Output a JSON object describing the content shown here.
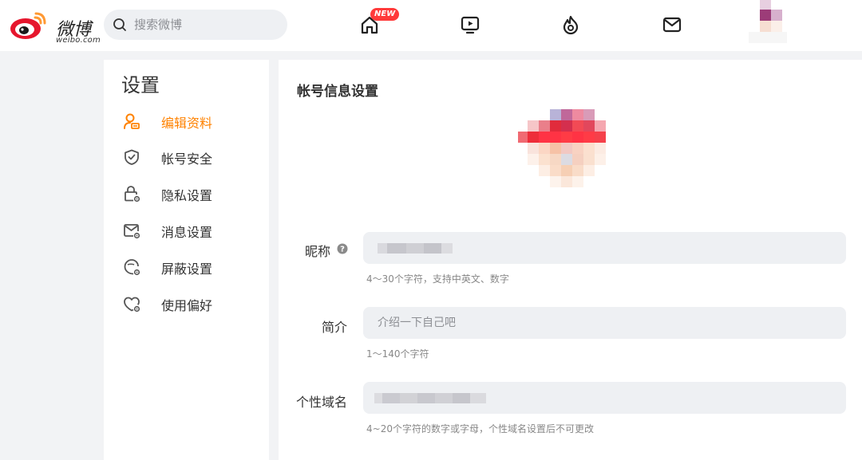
{
  "header": {
    "logo_text": "微博",
    "logo_sub": "weibo.com",
    "search_placeholder": "搜索微博",
    "nav": [
      {
        "name": "home",
        "badge": "NEW"
      },
      {
        "name": "video"
      },
      {
        "name": "hot"
      },
      {
        "name": "messages"
      }
    ],
    "accent_color": "#ff8200",
    "badge_color": "#ff3a3a"
  },
  "sidebar": {
    "title": "设置",
    "items": [
      {
        "label": "编辑资料",
        "icon": "user-edit-icon",
        "active": true
      },
      {
        "label": "帐号安全",
        "icon": "shield-icon",
        "active": false
      },
      {
        "label": "隐私设置",
        "icon": "lock-gear-icon",
        "active": false
      },
      {
        "label": "消息设置",
        "icon": "mail-gear-icon",
        "active": false
      },
      {
        "label": "屏蔽设置",
        "icon": "block-gear-icon",
        "active": false
      },
      {
        "label": "使用偏好",
        "icon": "heart-gear-icon",
        "active": false
      }
    ]
  },
  "main": {
    "title": "帐号信息设置",
    "fields": {
      "nickname": {
        "label": "昵称",
        "value": "",
        "hint": "4～30个字符，支持中英文、数字"
      },
      "bio": {
        "label": "简介",
        "placeholder": "介绍一下自己吧",
        "hint": "1～140个字符"
      },
      "domain": {
        "label": "个性域名",
        "value": "",
        "hint": "4~20个字符的数字或字母，个性域名设置后不可更改"
      }
    }
  }
}
